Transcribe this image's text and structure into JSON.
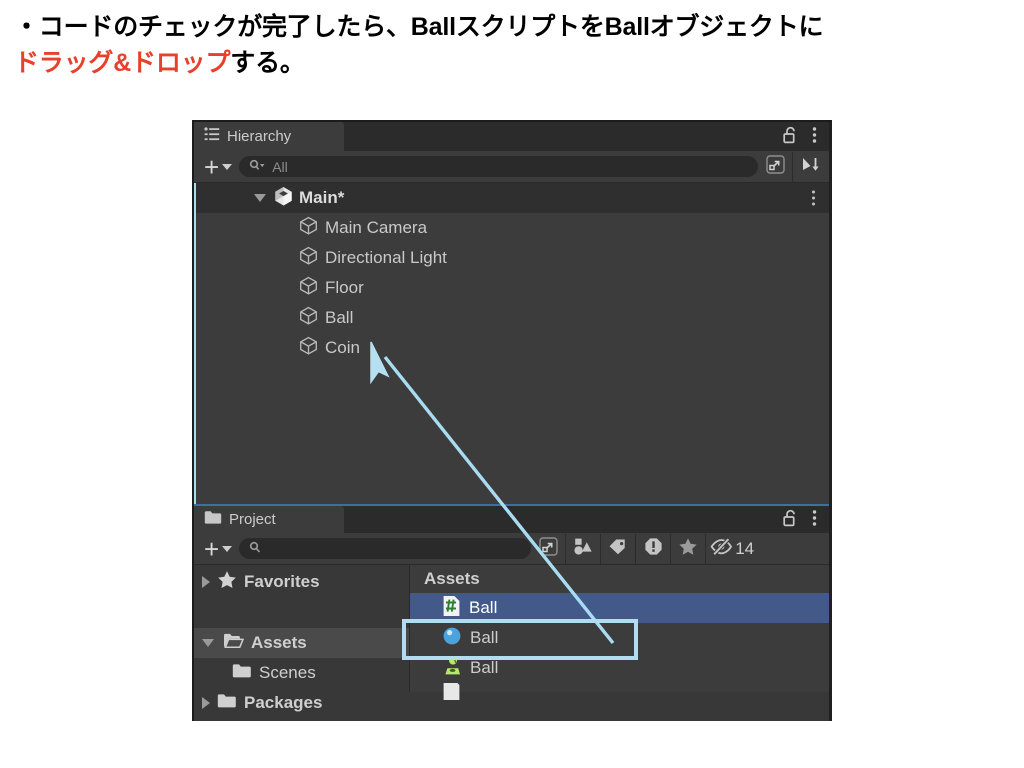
{
  "caption": {
    "line1": "・コードのチェックが完了したら、BallスクリプトをBallオブジェクトに",
    "line2_highlight": "ドラッグ&ドロップ",
    "line2_rest": "する。",
    "highlight_color": "#e8402a"
  },
  "hierarchy": {
    "tab_label": "Hierarchy",
    "tab_icon": "hierarchy-icon",
    "lock_icon": "unlocked-padlock-icon",
    "menu_icon": "kebab-menu-icon",
    "toolbar": {
      "add_label": "+",
      "search_placeholder": "All",
      "search_value": "",
      "search_icon": "search-dropdown-icon",
      "expand_icon": "expand-window-icon",
      "sort_icon": "sort-descending-icon"
    },
    "scene": {
      "name": "Main*",
      "modified": true
    },
    "objects": [
      {
        "name": "Main Camera",
        "icon": "gameobject-cube-icon"
      },
      {
        "name": "Directional Light",
        "icon": "gameobject-cube-icon"
      },
      {
        "name": "Floor",
        "icon": "gameobject-cube-icon"
      },
      {
        "name": "Ball",
        "icon": "gameobject-cube-icon"
      },
      {
        "name": "Coin",
        "icon": "gameobject-cube-icon"
      }
    ]
  },
  "project": {
    "tab_label": "Project",
    "tab_icon": "folder-icon",
    "lock_icon": "unlocked-padlock-icon",
    "menu_icon": "kebab-menu-icon",
    "active_accent": "#3d6ea5",
    "toolbar": {
      "add_label": "+",
      "search_placeholder": "",
      "search_value": "",
      "search_icon": "search-icon",
      "expand_icon": "expand-window-icon",
      "filters": [
        {
          "icon": "shapes-filter-icon",
          "label": ""
        },
        {
          "icon": "tag-filter-icon",
          "label": ""
        },
        {
          "icon": "warning-filter-icon",
          "label": ""
        },
        {
          "icon": "star-filter-icon",
          "label": ""
        },
        {
          "icon": "hidden-eye-icon",
          "label": "14"
        }
      ]
    },
    "tree": [
      {
        "label": "Favorites",
        "icon": "star-icon",
        "expanded": false,
        "depth": 0,
        "selected": false
      },
      {
        "label": "Assets",
        "icon": "folder-open-icon",
        "expanded": true,
        "depth": 0,
        "selected": true
      },
      {
        "label": "Scenes",
        "icon": "folder-icon",
        "expanded": null,
        "depth": 1,
        "selected": false
      },
      {
        "label": "Packages",
        "icon": "folder-icon",
        "expanded": false,
        "depth": 0,
        "selected": false
      }
    ],
    "breadcrumb": "Assets",
    "assets": [
      {
        "name": "Ball",
        "icon": "csharp-script-icon",
        "selected": true
      },
      {
        "name": "Ball",
        "icon": "material-sphere-icon",
        "selected": false
      },
      {
        "name": "Ball",
        "icon": "physic-material-icon",
        "selected": false
      },
      {
        "name": "",
        "icon": "prefab-icon",
        "selected": false
      }
    ]
  },
  "annotation": {
    "highlight_box_color": "#b2dcef",
    "arrow_color": "#a9dcf0",
    "cursor_icon": "mouse-pointer-icon",
    "arrow_from": "project-asset-ball-script",
    "arrow_to": "hierarchy-object-ball"
  }
}
